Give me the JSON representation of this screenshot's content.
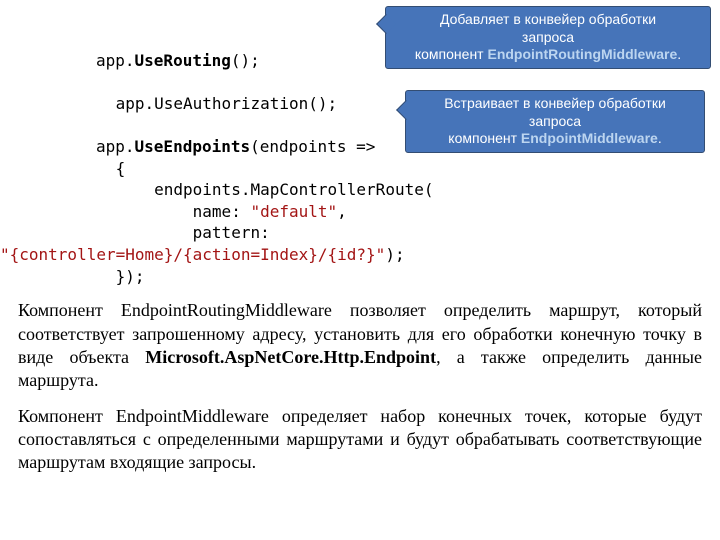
{
  "code": {
    "l1a": "app.",
    "l1b": "UseRouting",
    "l1c": "();",
    "l2": "            app.UseAuthorization();",
    "l3a": "app.",
    "l3b": "UseEndpoints",
    "l3c": "(endpoints =>",
    "l4": "            {",
    "l5": "                endpoints.MapControllerRoute(",
    "l6a": "                    name: ",
    "l6b": "\"default\"",
    "l6c": ",",
    "l7": "                    pattern:",
    "l8a": "\"{controller=Home}/{action=Index}/{id?}\"",
    "l8b": ");",
    "l9": "            });"
  },
  "callout1": {
    "line1": "Добавляет в конвейер обработки",
    "line2": "запроса",
    "line3_pre": "компонент ",
    "line3_accent": "EndpointRoutingMiddleware"
  },
  "callout2": {
    "line1": "Встраивает в конвейер обработки",
    "line2": "запроса",
    "line3_pre": "компонент ",
    "line3_accent": "EndpointMiddleware"
  },
  "para1": {
    "t1": "Компонент EndpointRoutingMiddleware позволяет определить маршрут, который соответствует запрошенному адресу, установить для его обработки конечную точку в виде объекта ",
    "strong": "Microsoft.AspNetCore.Http.Endpoint",
    "t2": ", а также определить данные маршрута."
  },
  "para2": "Компонент EndpointMiddleware определяет набор конечных точек, которые будут сопоставляться с определенными маршрутами и будут обрабатывать соответствующие маршрутам входящие запросы."
}
